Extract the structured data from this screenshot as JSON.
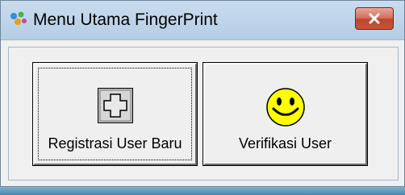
{
  "window": {
    "title": "Menu Utama FingerPrint"
  },
  "buttons": {
    "register_label": "Registrasi User Baru",
    "verify_label": "Verifikasi User"
  },
  "icons": {
    "app": "fingerprint-app-icon",
    "close": "close-icon",
    "register": "plus-icon",
    "verify": "smiley-icon"
  },
  "colors": {
    "titlebar": "#c9dcef",
    "close_button": "#c7503a",
    "smiley_face": "#ffff00",
    "window_body": "#f0f0f0"
  }
}
